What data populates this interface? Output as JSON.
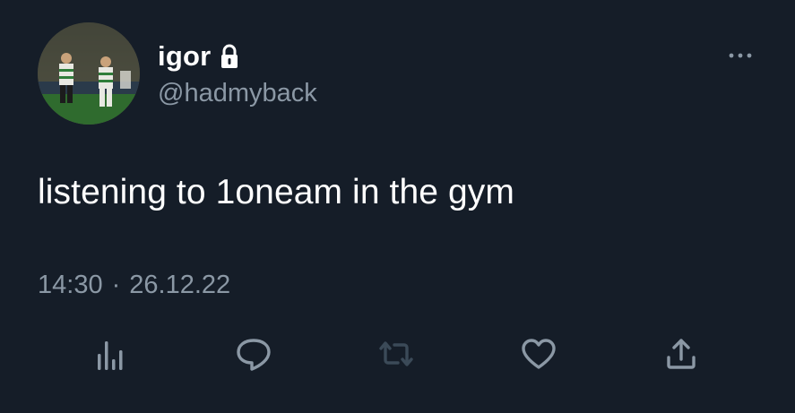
{
  "author": {
    "display_name": "igor",
    "handle": "@hadmyback",
    "protected_icon": "lock-icon",
    "avatar": "football-players-photo"
  },
  "tweet": {
    "text": "listening to 1oneam in the gym",
    "time": "14:30",
    "separator": "·",
    "date": "26.12.22"
  },
  "actions": [
    {
      "name": "analytics",
      "icon": "analytics-icon"
    },
    {
      "name": "reply",
      "icon": "reply-icon"
    },
    {
      "name": "retweet",
      "icon": "retweet-icon"
    },
    {
      "name": "like",
      "icon": "heart-icon"
    },
    {
      "name": "share",
      "icon": "share-icon"
    }
  ],
  "menu": {
    "icon": "more-icon"
  },
  "colors": {
    "background": "#151d28",
    "primary_text": "#ffffff",
    "secondary_text": "#8b98a5",
    "icon": "#8b98a5",
    "retweet_disabled": "#3b4a58"
  }
}
